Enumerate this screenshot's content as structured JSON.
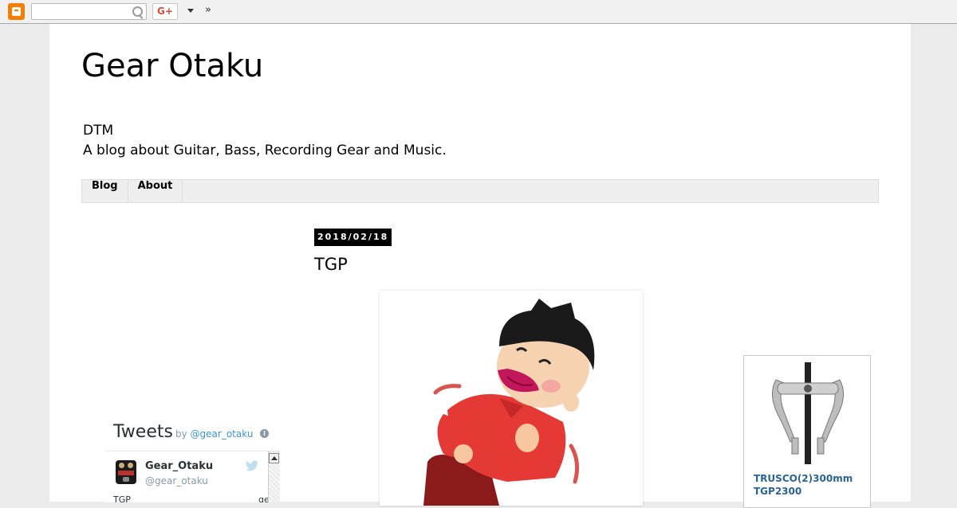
{
  "navbar": {
    "search_placeholder": "",
    "gplus_label": "G+",
    "more_label": "»"
  },
  "blog": {
    "title": "Gear Otaku",
    "desc_line1": "DTM",
    "desc_line2": "A blog about Guitar, Bass, Recording Gear and Music."
  },
  "tabs": [
    {
      "label": "Blog"
    },
    {
      "label": "About"
    }
  ],
  "post": {
    "date": "2018/02/18",
    "title": "TGP"
  },
  "tweets": {
    "title": "Tweets",
    "by_prefix": "by",
    "by_handle": "@gear_otaku",
    "info": "i",
    "name": "Gear_Otaku",
    "handle": "@gear_otaku",
    "text": "TGP",
    "text_cut": "ge"
  },
  "ad": {
    "line1": "TRUSCO(2)300mm",
    "line2": "TGP2300"
  },
  "colors": {
    "blogger_orange": "#f57d00",
    "link_blue": "#2a6496",
    "twitter_blue": "#3b94d9"
  }
}
